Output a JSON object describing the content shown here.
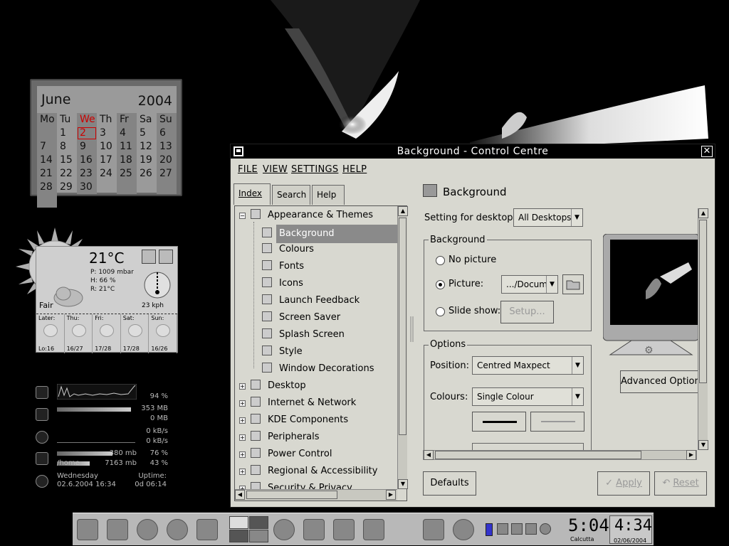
{
  "calendar": {
    "month": "June",
    "year": "2004",
    "weekdays": [
      "Mo",
      "Tu",
      "We",
      "Th",
      "Fr",
      "Sa",
      "Su"
    ],
    "days": [
      "",
      "1",
      "2",
      "3",
      "4",
      "5",
      "6",
      "7",
      "8",
      "9",
      "10",
      "11",
      "12",
      "13",
      "14",
      "15",
      "16",
      "17",
      "18",
      "19",
      "20",
      "21",
      "22",
      "23",
      "24",
      "25",
      "26",
      "27",
      "28",
      "29",
      "30",
      "",
      "",
      "",
      "",
      ""
    ],
    "today": "2"
  },
  "weather": {
    "temperature": "21°C",
    "pressure": "P: 1009 mbar",
    "humidity": "H: 66 %",
    "realfeel": "R: 21°C",
    "condition": "Fair",
    "wind_speed": "23 kph",
    "forecast": [
      {
        "day": "Later:",
        "temp": "Lo:16"
      },
      {
        "day": "Thu:",
        "temp": "16/27"
      },
      {
        "day": "Fri:",
        "temp": "17/28"
      },
      {
        "day": "Sat:",
        "temp": "17/28"
      },
      {
        "day": "Sun:",
        "temp": "16/26"
      }
    ]
  },
  "sysmon": {
    "cpu": "94 %",
    "mem": "353 MB",
    "swap": "0 MB",
    "net_in": "0 kB/s",
    "net_out": "0 kB/s",
    "disk1_used": "380 mb",
    "disk1_pct": "76 %",
    "disk2_label": "/home",
    "disk2_used": "7163 mb",
    "disk2_pct": "43 %",
    "day": "Wednesday",
    "datetime": "02.6.2004 16:34",
    "uptime_label": "Uptime:",
    "uptime": "0d 06:14"
  },
  "window": {
    "title": "Background - Control Centre",
    "menu": [
      "FILE",
      "VIEW",
      "SETTINGS",
      "HELP"
    ],
    "tabs": [
      "Index",
      "Search",
      "Help"
    ],
    "tree": [
      {
        "label": "Appearance & Themes",
        "level": 0,
        "expander": "minus"
      },
      {
        "label": "Background",
        "level": 1,
        "selected": true
      },
      {
        "label": "Colours",
        "level": 1
      },
      {
        "label": "Fonts",
        "level": 1
      },
      {
        "label": "Icons",
        "level": 1
      },
      {
        "label": "Launch Feedback",
        "level": 1
      },
      {
        "label": "Screen Saver",
        "level": 1
      },
      {
        "label": "Splash Screen",
        "level": 1
      },
      {
        "label": "Style",
        "level": 1
      },
      {
        "label": "Window Decorations",
        "level": 1
      },
      {
        "label": "Desktop",
        "level": 0,
        "expander": "plus"
      },
      {
        "label": "Internet & Network",
        "level": 0,
        "expander": "plus"
      },
      {
        "label": "KDE Components",
        "level": 0,
        "expander": "plus"
      },
      {
        "label": "Peripherals",
        "level": 0,
        "expander": "plus"
      },
      {
        "label": "Power Control",
        "level": 0,
        "expander": "plus"
      },
      {
        "label": "Regional & Accessibility",
        "level": 0,
        "expander": "plus"
      },
      {
        "label": "Security & Privacy",
        "level": 0,
        "expander": "plus"
      }
    ],
    "pane": {
      "title": "Background",
      "setting_for_desktop_label": "Setting for desktop:",
      "setting_for_desktop_value": "All Desktops",
      "background_group": "Background",
      "no_picture": "No picture",
      "picture": "Picture:",
      "picture_value": ".../Docum",
      "slide_show": "Slide show:",
      "setup": "Setup...",
      "options_group": "Options",
      "position_label": "Position:",
      "position_value": "Centred Maxpect",
      "colours_label": "Colours:",
      "colours_value": "Single Colour",
      "advanced": "Advanced Option"
    },
    "buttons": {
      "defaults": "Defaults",
      "apply": "Apply",
      "reset": "Reset"
    }
  },
  "taskbar": {
    "clock1_time": "5:04",
    "clock1_city": "Calcutta",
    "clock2_time": "4:34",
    "clock2_date": "02/06/2004"
  }
}
